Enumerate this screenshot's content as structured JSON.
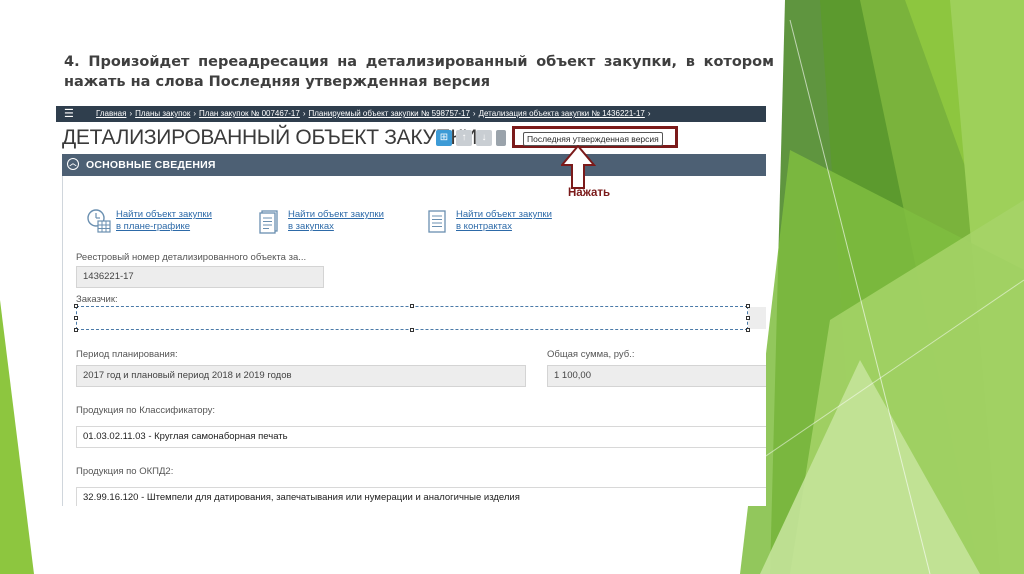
{
  "slide": {
    "title": "4. Произойдет переадресация на детализированный объект закупки, в котором нажать на слова Последняя утвержденная версия",
    "annotation": "Нажать",
    "annotation_color": "#7b1a1a",
    "accent_green": "#8dc63f"
  },
  "screenshot": {
    "breadcrumbs": [
      "Главная",
      "Планы закупок",
      "План закупок № 007467-17",
      "Планируемый объект закупки № 598757-17",
      "Детализация объекта закупки № 1436221-17"
    ],
    "breadcrumb_separator": "›",
    "heading": "ДЕТАЛИЗИРОВАННЫЙ ОБЪЕКТ ЗАКУПКИ",
    "version_button": "Последняя утвержденная версия",
    "section": {
      "title": "ОСНОВНЫЕ СВЕДЕНИЯ",
      "collapse_icon": "chevron-up-icon"
    },
    "links": [
      {
        "line1": "Найти объект закупки",
        "line2": "в плане-графике",
        "icon": "calendar-table-icon"
      },
      {
        "line1": "Найти объект закупки",
        "line2": "в закупках",
        "icon": "document-icon"
      },
      {
        "line1": "Найти объект закупки",
        "line2": "в контрактах",
        "icon": "list-document-icon"
      }
    ],
    "fields": {
      "registry_number_label": "Реестровый номер детализированного объекта за...",
      "registry_number_value": "1436221-17",
      "customer_label": "Заказчик:",
      "customer_value": "",
      "period_label": "Период планирования:",
      "period_value": "2017 год и плановый период 2018 и 2019 годов",
      "sum_label": "Общая сумма, руб.:",
      "sum_value": "1 100,00",
      "classifier_label": "Продукция по Классификатору:",
      "classifier_code": "01.03.02.11.03",
      "classifier_text": " - Круглая самонаборная печать",
      "okpd_label": "Продукция по ОКПД2:",
      "okpd_code": "32.99.16.120",
      "okpd_text": " - Штемпели для датирования, запечатывания или нумерации и аналогичные изделия"
    }
  }
}
